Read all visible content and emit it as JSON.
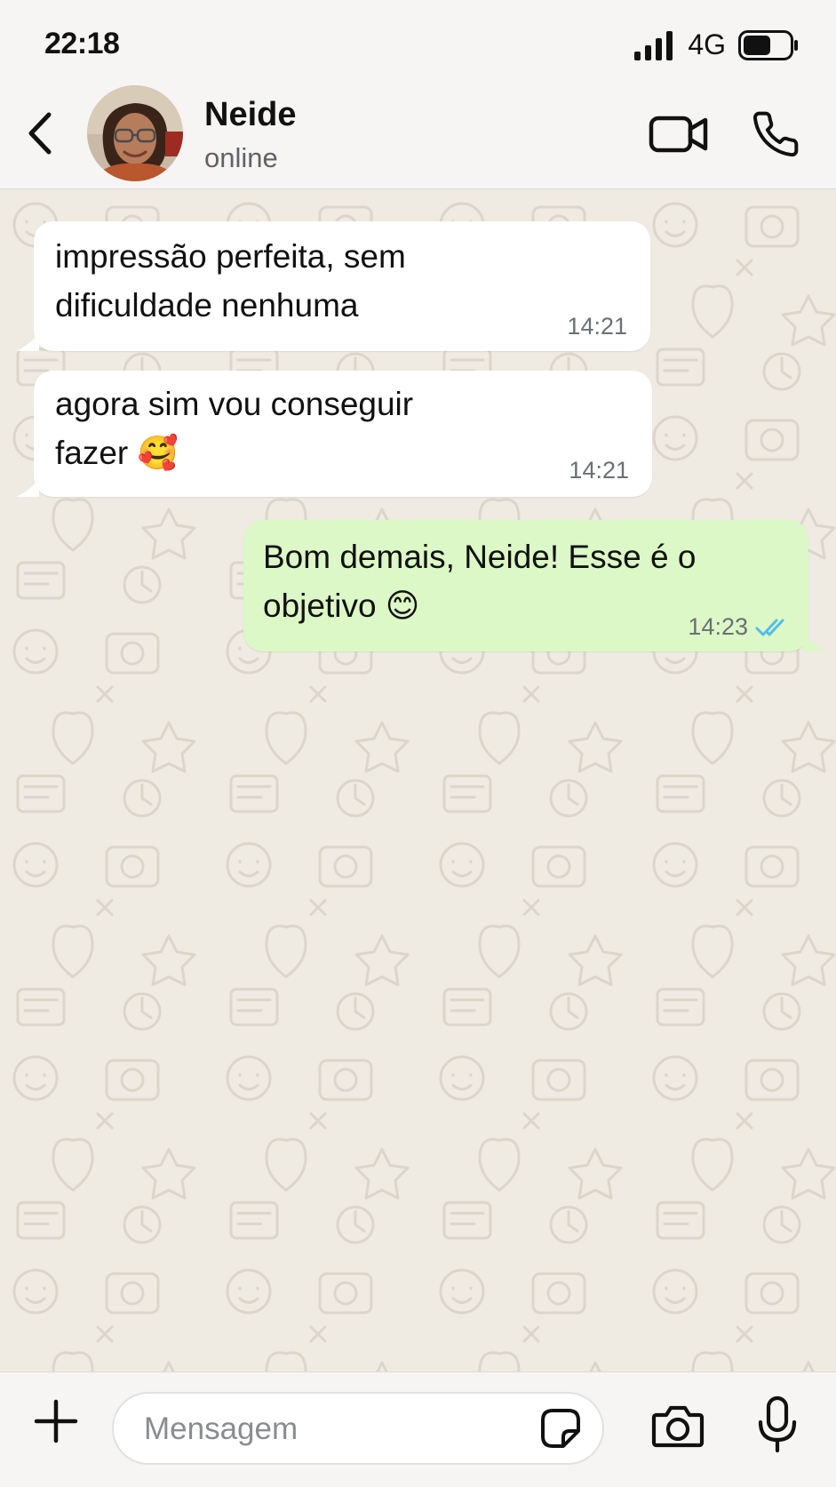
{
  "status_bar": {
    "time": "22:18",
    "network": "4G",
    "icons": [
      "signal-icon",
      "battery-icon"
    ]
  },
  "header": {
    "contact_name": "Neide",
    "contact_status": "online",
    "icons": [
      "back-arrow-icon",
      "video-call-icon",
      "phone-icon"
    ]
  },
  "messages": [
    {
      "direction": "incoming",
      "lines": [
        "impressão perfeita, sem",
        "dificuldade nenhuma"
      ],
      "time": "14:21"
    },
    {
      "direction": "incoming",
      "lines": [
        "agora sim vou conseguir",
        "fazer 🥰"
      ],
      "emoji_icon": "smiling-face-with-hearts-icon",
      "time": "14:21"
    },
    {
      "direction": "outgoing",
      "lines": [
        "Bom demais, Neide! Esse é o",
        "objetivo 😊"
      ],
      "emoji_icon": "smiling-face-icon",
      "time": "14:23",
      "read_status": "read",
      "read_icon": "double-check-icon"
    }
  ],
  "input_bar": {
    "placeholder": "Mensagem",
    "value": "",
    "icons": [
      "plus-icon",
      "sticker-icon",
      "camera-icon",
      "microphone-icon"
    ]
  },
  "colors": {
    "chat_background": "#efeae2",
    "header_background": "#f6f5f3",
    "incoming_bubble": "#ffffff",
    "outgoing_bubble": "#dcf8c6",
    "read_ticks": "#53bdeb"
  }
}
